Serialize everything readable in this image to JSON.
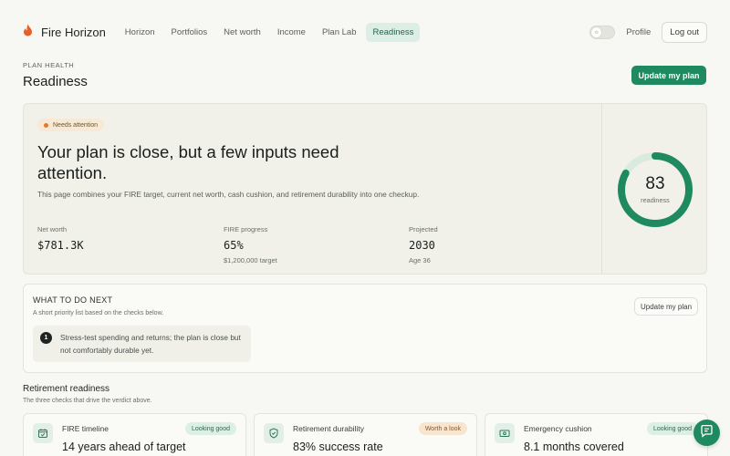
{
  "nav": {
    "brand": "Fire Horizon",
    "links": [
      "Horizon",
      "Portfolios",
      "Net worth",
      "Income",
      "Plan Lab",
      "Readiness"
    ],
    "profile": "Profile",
    "logout": "Log out"
  },
  "header": {
    "eyebrow": "PLAN HEALTH",
    "title": "Readiness",
    "cta": "Update my plan"
  },
  "hero": {
    "badge": "Needs attention",
    "title": "Your plan is close, but a few inputs need attention.",
    "description": "This page combines your FIRE target, current net worth, cash cushion, and retirement durability into one checkup.",
    "stats": [
      {
        "label": "Net worth",
        "value": "$781.3K",
        "sub": ""
      },
      {
        "label": "FIRE progress",
        "value": "65%",
        "sub": "$1,200,000 target"
      },
      {
        "label": "Projected",
        "value": "2030",
        "sub": "Age 36"
      }
    ],
    "score": {
      "value": "83",
      "label": "readiness",
      "fraction": 0.83
    }
  },
  "next": {
    "title": "WHAT TO DO NEXT",
    "subtitle": "A short priority list based on the checks below.",
    "button": "Update my plan",
    "items": [
      {
        "num": "1",
        "text": "Stress-test spending and returns; the plan is close but not comfortably durable yet."
      }
    ]
  },
  "readiness": {
    "title": "Retirement readiness",
    "subtitle": "The three checks that drive the verdict above.",
    "checks": [
      {
        "label": "FIRE timeline",
        "value": "14 years ahead of target",
        "status": "Looking good",
        "icon": "calendar-check-icon"
      },
      {
        "label": "Retirement durability",
        "value": "83% success rate",
        "status": "Worth a look",
        "icon": "shield-check-icon"
      },
      {
        "label": "Emergency cushion",
        "value": "8.1 months covered",
        "status": "Looking good",
        "icon": "cash-icon"
      }
    ]
  },
  "colors": {
    "accent": "#1f8a5f",
    "active_tab_bg": "#dcefe6",
    "attention": "#e07b2a",
    "ring_track": "#d9eadf"
  }
}
